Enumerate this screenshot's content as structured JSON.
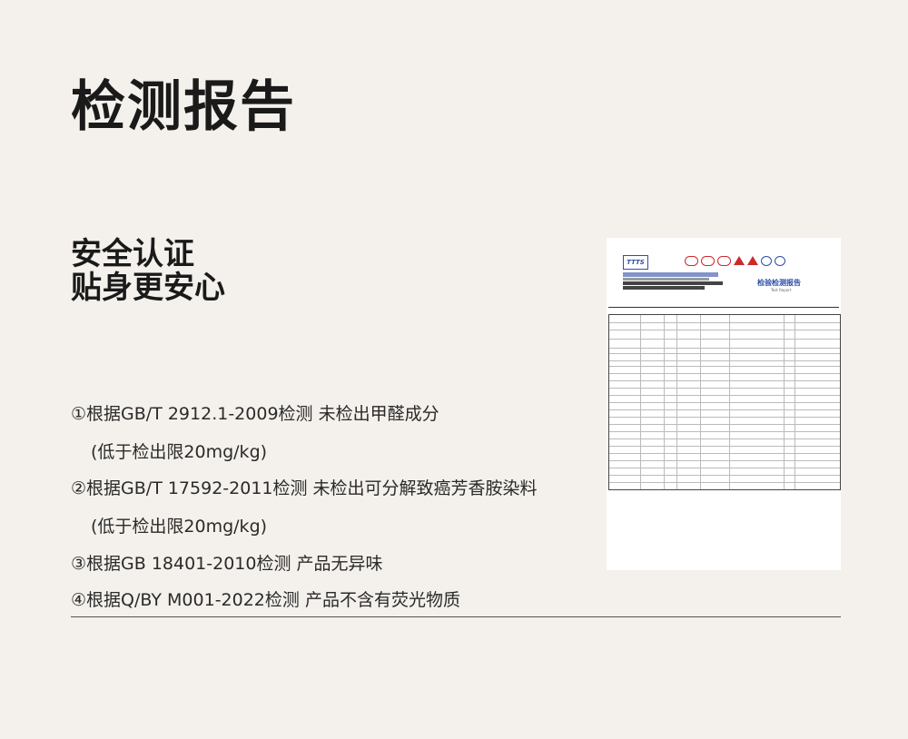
{
  "title": "检测报告",
  "subtitle": {
    "line1": "安全认证",
    "line2": "贴身更安心"
  },
  "items": [
    {
      "text": "①根据GB/T 2912.1-2009检测 未检出甲醛成分",
      "sub": "(低于检出限20mg/kg)"
    },
    {
      "text": "②根据GB/T 17592-2011检测 未检出可分解致癌芳香胺染料",
      "sub": "(低于检出限20mg/kg)"
    },
    {
      "text": "③根据GB 18401-2010检测 产品无异味"
    },
    {
      "text": "④根据Q/BY M001-2022检测 产品不含有荧光物质"
    }
  ],
  "report": {
    "logo": "TTTS",
    "doc_title": "检验检测报告",
    "doc_subtitle": "Test Report"
  },
  "colors": {
    "background": "#f4f1ec",
    "report_blue": "#2d4fa8",
    "seal_red": "#cc2b2b"
  }
}
